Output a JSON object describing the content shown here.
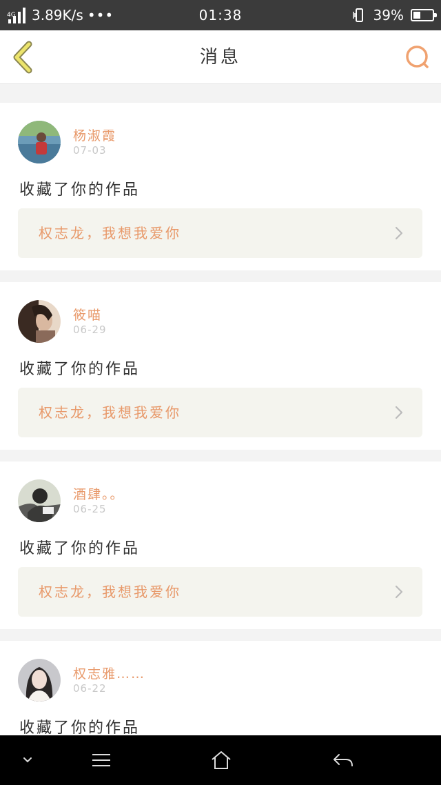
{
  "status_bar": {
    "network_type": "4G",
    "net_speed": "3.89K/s",
    "more_indicator": "•••",
    "time": "01:38",
    "battery_percent": "39%",
    "battery_level": 0.39,
    "icons": [
      "signal-icon",
      "vibrate-icon",
      "battery-icon"
    ]
  },
  "title_bar": {
    "title": "消息",
    "back_icon": "chevron-left-icon",
    "search_icon": "search-icon",
    "accent_color": "#e8996a",
    "back_color": "#e8e070"
  },
  "messages": [
    {
      "user": "杨淑霞",
      "date": "07-03",
      "action": "收藏了你的作品",
      "work_title": "权志龙，我想我爱你"
    },
    {
      "user": "筱喵",
      "date": "06-29",
      "action": "收藏了你的作品",
      "work_title": "权志龙，我想我爱你"
    },
    {
      "user": "酒肆。。",
      "date": "06-25",
      "action": "收藏了你的作品",
      "work_title": "权志龙，我想我爱你"
    },
    {
      "user": "权志雅……",
      "date": "06-22",
      "action": "收藏了你的作品",
      "work_title": ""
    }
  ],
  "nav_bar": {
    "icons": [
      "chevron-down-icon",
      "menu-icon",
      "home-icon",
      "back-arrow-icon"
    ]
  }
}
